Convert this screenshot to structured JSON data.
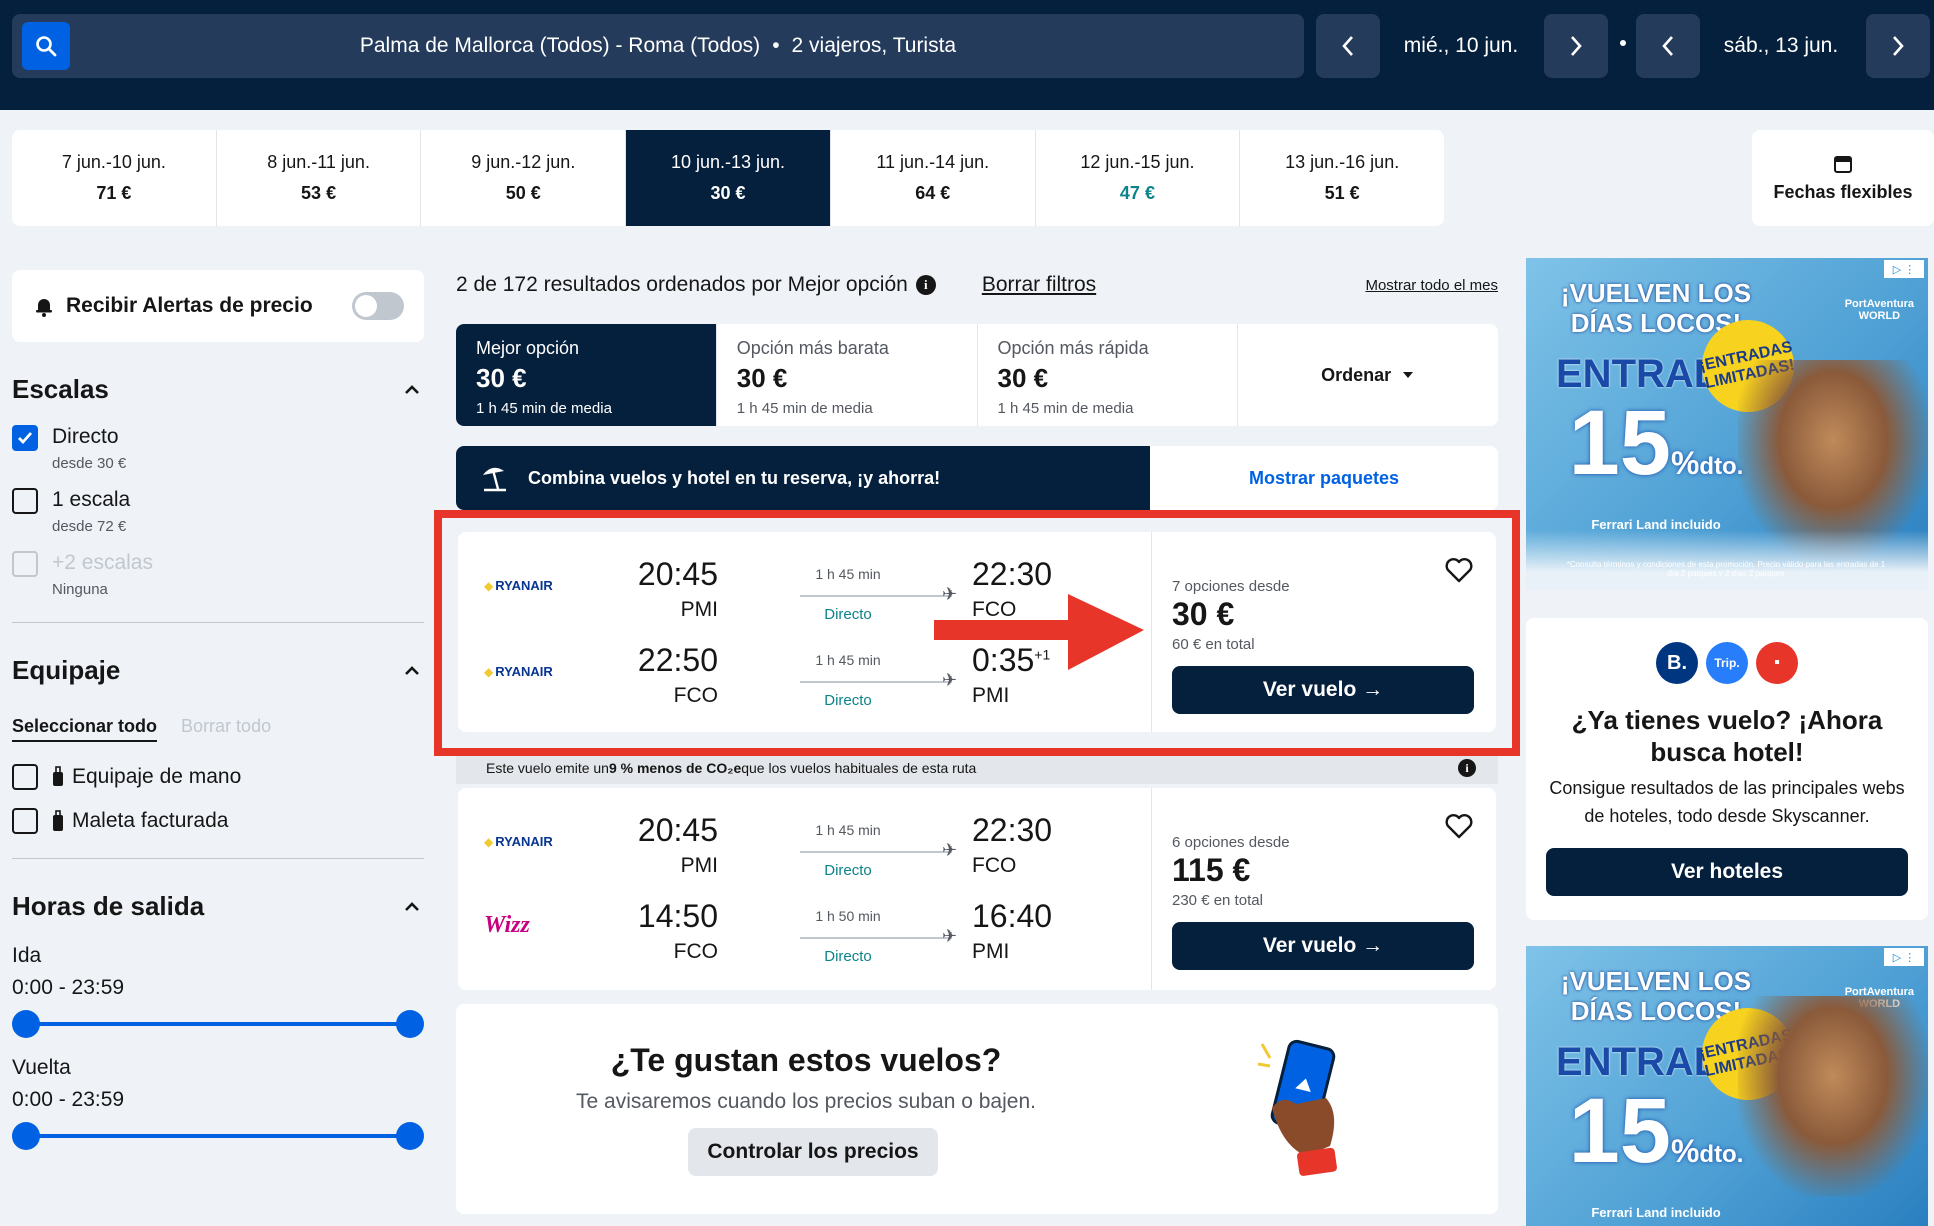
{
  "search": {
    "route": "Palma de Mallorca (Todos) - Roma (Todos)",
    "sep": "•",
    "travellers": "2 viajeros, Turista",
    "depart_date": "mié., 10 jun.",
    "return_date": "sáb., 13 jun."
  },
  "date_strip": [
    {
      "range": "7 jun.-10 jun.",
      "price": "71 €"
    },
    {
      "range": "8 jun.-11 jun.",
      "price": "53 €"
    },
    {
      "range": "9 jun.-12 jun.",
      "price": "50 €"
    },
    {
      "range": "10 jun.-13 jun.",
      "price": "30 €"
    },
    {
      "range": "11 jun.-14 jun.",
      "price": "64 €"
    },
    {
      "range": "12 jun.-15 jun.",
      "price": "47 €"
    },
    {
      "range": "13 jun.-16 jun.",
      "price": "51 €"
    }
  ],
  "flex_dates": "Fechas flexibles",
  "sidebar": {
    "alerts_label": "Recibir Alertas de precio",
    "stops_title": "Escalas",
    "stops": [
      {
        "label": "Directo",
        "sub": "desde 30 €",
        "checked": true
      },
      {
        "label": "1 escala",
        "sub": "desde 72 €",
        "checked": false
      },
      {
        "label": "+2 escalas",
        "sub": "Ninguna",
        "checked": false
      }
    ],
    "baggage_title": "Equipaje",
    "select_all": "Seleccionar todo",
    "clear_all": "Borrar todo",
    "baggage": [
      "Equipaje de mano",
      "Maleta facturada"
    ],
    "times_title": "Horas de salida",
    "outbound_label": "Ida",
    "outbound_range": "0:00 - 23:59",
    "return_label": "Vuelta",
    "return_range": "0:00 - 23:59"
  },
  "results": {
    "summary": "2 de 172 resultados ordenados por Mejor opción",
    "clear_filters": "Borrar filtros",
    "show_month": "Mostrar todo el mes"
  },
  "sort_tabs": [
    {
      "title": "Mejor opción",
      "price": "30 €",
      "sub": "1 h 45 min de media"
    },
    {
      "title": "Opción más barata",
      "price": "30 €",
      "sub": "1 h 45 min de media"
    },
    {
      "title": "Opción más rápida",
      "price": "30 €",
      "sub": "1 h 45 min de media"
    }
  ],
  "order_label": "Ordenar",
  "combo": {
    "text": "Combina vuelos y hotel en tu reserva, ¡y ahorra!",
    "link": "Mostrar paquetes"
  },
  "flights": [
    {
      "legs": [
        {
          "airline": "RYANAIR",
          "dep_time": "20:45",
          "dep_code": "PMI",
          "duration": "1 h 45 min",
          "stops": "Directo",
          "arr_time": "22:30",
          "arr_code": "FCO",
          "plus": ""
        },
        {
          "airline": "RYANAIR",
          "dep_time": "22:50",
          "dep_code": "FCO",
          "duration": "1 h 45 min",
          "stops": "Directo",
          "arr_time": "0:35",
          "arr_code": "PMI",
          "plus": "+1"
        }
      ],
      "options": "7 opciones desde",
      "price": "30 €",
      "total": "60 € en total",
      "button": "Ver vuelo →"
    },
    {
      "legs": [
        {
          "airline": "RYANAIR",
          "dep_time": "20:45",
          "dep_code": "PMI",
          "duration": "1 h 45 min",
          "stops": "Directo",
          "arr_time": "22:30",
          "arr_code": "FCO",
          "plus": ""
        },
        {
          "airline": "Wizz",
          "dep_time": "14:50",
          "dep_code": "FCO",
          "duration": "1 h 50 min",
          "stops": "Directo",
          "arr_time": "16:40",
          "arr_code": "PMI",
          "plus": ""
        }
      ],
      "options": "6 opciones desde",
      "price": "115 €",
      "total": "230 € en total",
      "button": "Ver vuelo →"
    }
  ],
  "eco": {
    "pre": "Este vuelo emite un ",
    "bold": "9 % menos de CO₂e",
    "post": " que los vuelos habituales de esta ruta",
    "info": "i"
  },
  "like": {
    "title": "¿Te gustan estos vuelos?",
    "sub": "Te avisaremos cuando los precios suban o bajen.",
    "button": "Controlar los precios"
  },
  "ad": {
    "line1": "¡VUELVEN LOS",
    "line1b": "DÍAS LOCOS!",
    "line2": "ENTRADAS",
    "line3": "15",
    "line3b": "%",
    "line3c": "dto.",
    "line4": "Ferrari Land incluido",
    "badge": "¡ENTRADAS LIMITADAS!",
    "brand": "PortAventura",
    "brand2": "WORLD",
    "fine": "*Consulta términos y condiciones de esta promoción. Precio válido para las entradas de 1 día 2 parques y 2 días 2 parques"
  },
  "hotel": {
    "title": "¿Ya tienes vuelo? ¡Ahora busca hotel!",
    "sub": "Consigue resultados de las principales webs de hoteles, todo desde Skyscanner.",
    "button": "Ver hoteles",
    "logo1": "B.",
    "logo2": "Trip.",
    "logo3": "▪"
  },
  "colors": {
    "navy": "#05203c",
    "blue": "#0062e3",
    "teal": "#0c838a",
    "highlight_red": "#e7352a"
  }
}
